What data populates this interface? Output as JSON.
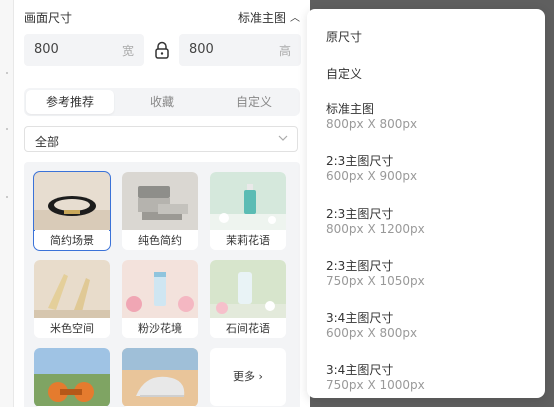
{
  "canvas_size": {
    "title": "画面尺寸",
    "preset_label": "标准主图",
    "width_value": "800",
    "width_unit": "宽",
    "height_value": "800",
    "height_unit": "高"
  },
  "tabs": [
    {
      "label": "参考推荐",
      "active": true
    },
    {
      "label": "收藏",
      "active": false
    },
    {
      "label": "自定义",
      "active": false
    }
  ],
  "filter": {
    "selected": "全部"
  },
  "templates": [
    {
      "label": "简约场景",
      "selected": true
    },
    {
      "label": "纯色简约",
      "selected": false
    },
    {
      "label": "茉莉花语",
      "selected": false
    },
    {
      "label": "米色空间",
      "selected": false
    },
    {
      "label": "粉沙花境",
      "selected": false
    },
    {
      "label": "石间花语",
      "selected": false
    }
  ],
  "more_label": "更多",
  "size_options": [
    {
      "name": "原尺寸",
      "detail": ""
    },
    {
      "name": "自定义",
      "detail": ""
    },
    {
      "name": "标准主图",
      "detail": "800px X 800px"
    },
    {
      "name": "2:3主图尺寸",
      "detail": "600px X 900px"
    },
    {
      "name": "2:3主图尺寸",
      "detail": "800px X 1200px"
    },
    {
      "name": "2:3主图尺寸",
      "detail": "750px X 1050px"
    },
    {
      "name": "3:4主图尺寸",
      "detail": "600px X 800px"
    },
    {
      "name": "3:4主图尺寸",
      "detail": "750px X 1000px"
    }
  ],
  "colors": {
    "accent": "#3a72d8",
    "panel_bg": "#f3f4f6",
    "overlay": "#5f5f5f"
  }
}
